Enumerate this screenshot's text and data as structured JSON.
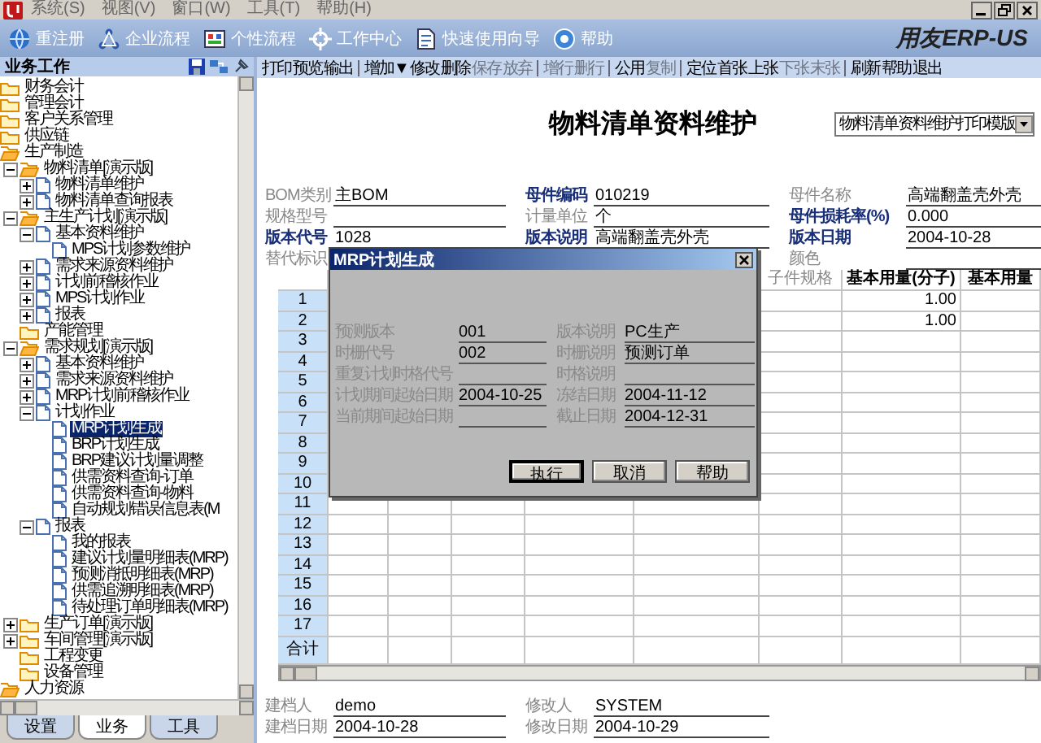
{
  "menubar": {
    "items": [
      "系统(S)",
      "视图(V)",
      "窗口(W)",
      "工具(T)",
      "帮助(H)"
    ]
  },
  "quickbar": {
    "items": [
      "重注册",
      "企业流程",
      "个性流程",
      "工作中心",
      "快速使用向导",
      "帮助"
    ],
    "logo": "用友ERP-US"
  },
  "sidebar": {
    "title": "业务工作",
    "tree": [
      {
        "label": "财务会计",
        "kind": "folder",
        "selected": false
      },
      {
        "label": "管理会计",
        "kind": "folder",
        "selected": false
      },
      {
        "label": "客户关系管理",
        "kind": "folder",
        "selected": false
      },
      {
        "label": "供应链",
        "kind": "folder",
        "selected": false
      },
      {
        "label": "生产制造",
        "kind": "folder-open",
        "selected": false,
        "children": [
          {
            "label": "物料清单[演示版]",
            "kind": "folder-open",
            "expanded": true,
            "selected": false,
            "children": [
              {
                "label": "物料清单维护",
                "kind": "page",
                "expanded": false,
                "selected": false
              },
              {
                "label": "物料清单查询报表",
                "kind": "page",
                "expanded": false,
                "selected": false
              }
            ]
          },
          {
            "label": "主生产计划[演示版]",
            "kind": "folder-open",
            "expanded": true,
            "selected": false,
            "children": [
              {
                "label": "基本资料维护",
                "kind": "page",
                "expanded": true,
                "selected": false,
                "children": [
                  {
                    "label": "MPS计划参数维护",
                    "kind": "page",
                    "selected": false
                  }
                ]
              },
              {
                "label": "需求来源资料维护",
                "kind": "page",
                "expanded": false,
                "selected": false
              },
              {
                "label": "计划前稽核作业",
                "kind": "page",
                "expanded": false,
                "selected": false
              },
              {
                "label": "MPS计划作业",
                "kind": "page",
                "expanded": false,
                "selected": false
              },
              {
                "label": "报表",
                "kind": "page",
                "expanded": false,
                "selected": false
              }
            ]
          },
          {
            "label": "产能管理",
            "kind": "folder",
            "selected": false
          },
          {
            "label": "需求规划[演示版]",
            "kind": "folder-open",
            "expanded": true,
            "selected": false,
            "children": [
              {
                "label": "基本资料维护",
                "kind": "page",
                "expanded": false,
                "selected": false
              },
              {
                "label": "需求来源资料维护",
                "kind": "page",
                "expanded": false,
                "selected": false
              },
              {
                "label": "MRP计划前稽核作业",
                "kind": "page",
                "expanded": false,
                "selected": false
              },
              {
                "label": "计划作业",
                "kind": "page",
                "expanded": true,
                "selected": false,
                "children": [
                  {
                    "label": "MRP计划生成",
                    "kind": "page",
                    "selected": true
                  },
                  {
                    "label": "BRP计划生成",
                    "kind": "page",
                    "selected": false
                  },
                  {
                    "label": "BRP建议计划量调整",
                    "kind": "page",
                    "selected": false
                  },
                  {
                    "label": "供需资料查询-订单",
                    "kind": "page",
                    "selected": false
                  },
                  {
                    "label": "供需资料查询-物料",
                    "kind": "page",
                    "selected": false
                  },
                  {
                    "label": "自动规划错误信息表(M",
                    "kind": "page",
                    "selected": false
                  }
                ]
              },
              {
                "label": "报表",
                "kind": "page",
                "expanded": true,
                "selected": false,
                "children": [
                  {
                    "label": "我的报表",
                    "kind": "page",
                    "selected": false
                  },
                  {
                    "label": "建议计划量明细表(MRP)",
                    "kind": "page",
                    "selected": false
                  },
                  {
                    "label": "预测消抵明细表(MRP)",
                    "kind": "page",
                    "selected": false
                  },
                  {
                    "label": "供需追溯明细表(MRP)",
                    "kind": "page",
                    "selected": false
                  },
                  {
                    "label": "待处理订单明细表(MRP)",
                    "kind": "page",
                    "selected": false
                  }
                ]
              }
            ]
          },
          {
            "label": "生产订单[演示版]",
            "kind": "folder",
            "expanded": false,
            "selected": false
          },
          {
            "label": "车间管理[演示版]",
            "kind": "folder",
            "expanded": false,
            "selected": false
          },
          {
            "label": "工程变更",
            "kind": "folder",
            "selected": false
          },
          {
            "label": "设备管理",
            "kind": "folder",
            "selected": false
          }
        ]
      },
      {
        "label": "人力资源",
        "kind": "folder-open",
        "selected": false
      }
    ],
    "tabs": [
      {
        "label": "设置",
        "selected": false
      },
      {
        "label": "业务",
        "selected": true
      },
      {
        "label": "工具",
        "selected": false
      }
    ]
  },
  "toolbar": {
    "groups": [
      [
        {
          "label": "打印",
          "disabled": false
        },
        {
          "label": "预览",
          "disabled": false
        },
        {
          "label": "输出",
          "disabled": false
        }
      ],
      [
        {
          "label": "增加▼",
          "disabled": false
        },
        {
          "label": "修改",
          "disabled": false
        },
        {
          "label": "删除",
          "disabled": false
        },
        {
          "label": "保存",
          "disabled": true
        },
        {
          "label": "放弃",
          "disabled": true
        }
      ],
      [
        {
          "label": "增行",
          "disabled": true
        },
        {
          "label": "删行",
          "disabled": true
        }
      ],
      [
        {
          "label": "公用",
          "disabled": false
        },
        {
          "label": "复制",
          "disabled": true
        }
      ],
      [
        {
          "label": "定位",
          "disabled": false
        },
        {
          "label": "首张",
          "disabled": false
        },
        {
          "label": "上张",
          "disabled": false
        },
        {
          "label": "下张",
          "disabled": true
        },
        {
          "label": "末张",
          "disabled": true
        }
      ],
      [
        {
          "label": "刷新",
          "disabled": false
        },
        {
          "label": "帮助",
          "disabled": false
        },
        {
          "label": "退出",
          "disabled": false
        }
      ]
    ]
  },
  "form": {
    "title": "物料清单资料维护",
    "template": "物料清单资料维护打印模版",
    "field_rows": [
      {
        "left": {
          "label": "BOM类别",
          "value": "主BOM",
          "emphasis": false
        },
        "middle": {
          "label": "母件编码",
          "value": "010219",
          "emphasis": true
        },
        "right": {
          "label": "母件名称",
          "value": "高端翻盖壳外壳",
          "emphasis": false
        }
      },
      {
        "left": {
          "label": "规格型号",
          "emphasis": false
        },
        "middle": {
          "label": "计量单位",
          "value": "个",
          "emphasis": false
        },
        "right": {
          "label": "母件损耗率(%)",
          "value": "0.000",
          "emphasis": true
        }
      },
      {
        "left": {
          "label": "版本代号",
          "value": "1028",
          "emphasis": true
        },
        "middle": {
          "label": "版本说明",
          "value": "高端翻盖壳外壳",
          "emphasis": true
        },
        "right": {
          "label": "版本日期",
          "value": "2004-10-28",
          "emphasis": true
        }
      },
      {
        "left": {
          "label": "替代标识",
          "emphasis": false
        },
        "right": {
          "label": "颜色",
          "emphasis": false
        }
      }
    ]
  },
  "grid": {
    "columns": [
      {
        "label": "子件规格",
        "emphasis": false
      },
      {
        "label": "基本用量(分子)",
        "emphasis": true
      },
      {
        "label": "基本用量",
        "emphasis": true
      }
    ],
    "rows": [
      {
        "number": "1",
        "kind": "item",
        "quantity": "1.00"
      },
      {
        "number": "2",
        "kind": "item",
        "quantity": "1.00"
      },
      {
        "number": "3",
        "kind": "item"
      },
      {
        "number": "4",
        "kind": "item"
      },
      {
        "number": "5",
        "kind": "item"
      },
      {
        "number": "6",
        "kind": "item"
      },
      {
        "number": "7",
        "kind": "item"
      },
      {
        "number": "8",
        "kind": "item"
      },
      {
        "number": "9",
        "kind": "item"
      },
      {
        "number": "10",
        "kind": "item"
      },
      {
        "number": "11",
        "kind": "item"
      },
      {
        "number": "12",
        "kind": "item"
      },
      {
        "number": "13",
        "kind": "item"
      },
      {
        "number": "14",
        "kind": "item"
      },
      {
        "number": "15",
        "kind": "item"
      },
      {
        "number": "16",
        "kind": "item"
      },
      {
        "number": "17",
        "kind": "item"
      },
      {
        "number": "合计",
        "kind": "total"
      }
    ]
  },
  "footer": [
    {
      "label": "建档人",
      "value": "demo"
    },
    {
      "label": "修改人",
      "value": "SYSTEM"
    },
    {
      "label": "建档日期",
      "value": "2004-10-28"
    },
    {
      "label": "修改日期",
      "value": "2004-10-29"
    }
  ],
  "dialog": {
    "title": "MRP计划生成",
    "fields": [
      {
        "label": "预测版本",
        "value": "001"
      },
      {
        "label": "版本说明",
        "value": "PC生产"
      },
      {
        "label": "时栅代号",
        "value": "002"
      },
      {
        "label": "时栅说明",
        "value": "预测订单"
      },
      {
        "label": "重复计划时格代号"
      },
      {
        "label": "时格说明"
      },
      {
        "label": "计划期间起始日期",
        "value": "2004-10-25"
      },
      {
        "label": "冻结日期",
        "value": "2004-11-12"
      },
      {
        "label": "当前期间起始日期"
      },
      {
        "label": "截止日期",
        "value": "2004-12-31"
      }
    ],
    "buttons": [
      {
        "label": "执行",
        "default": true
      },
      {
        "label": "取消",
        "default": false
      },
      {
        "label": "帮助",
        "default": false
      }
    ]
  }
}
